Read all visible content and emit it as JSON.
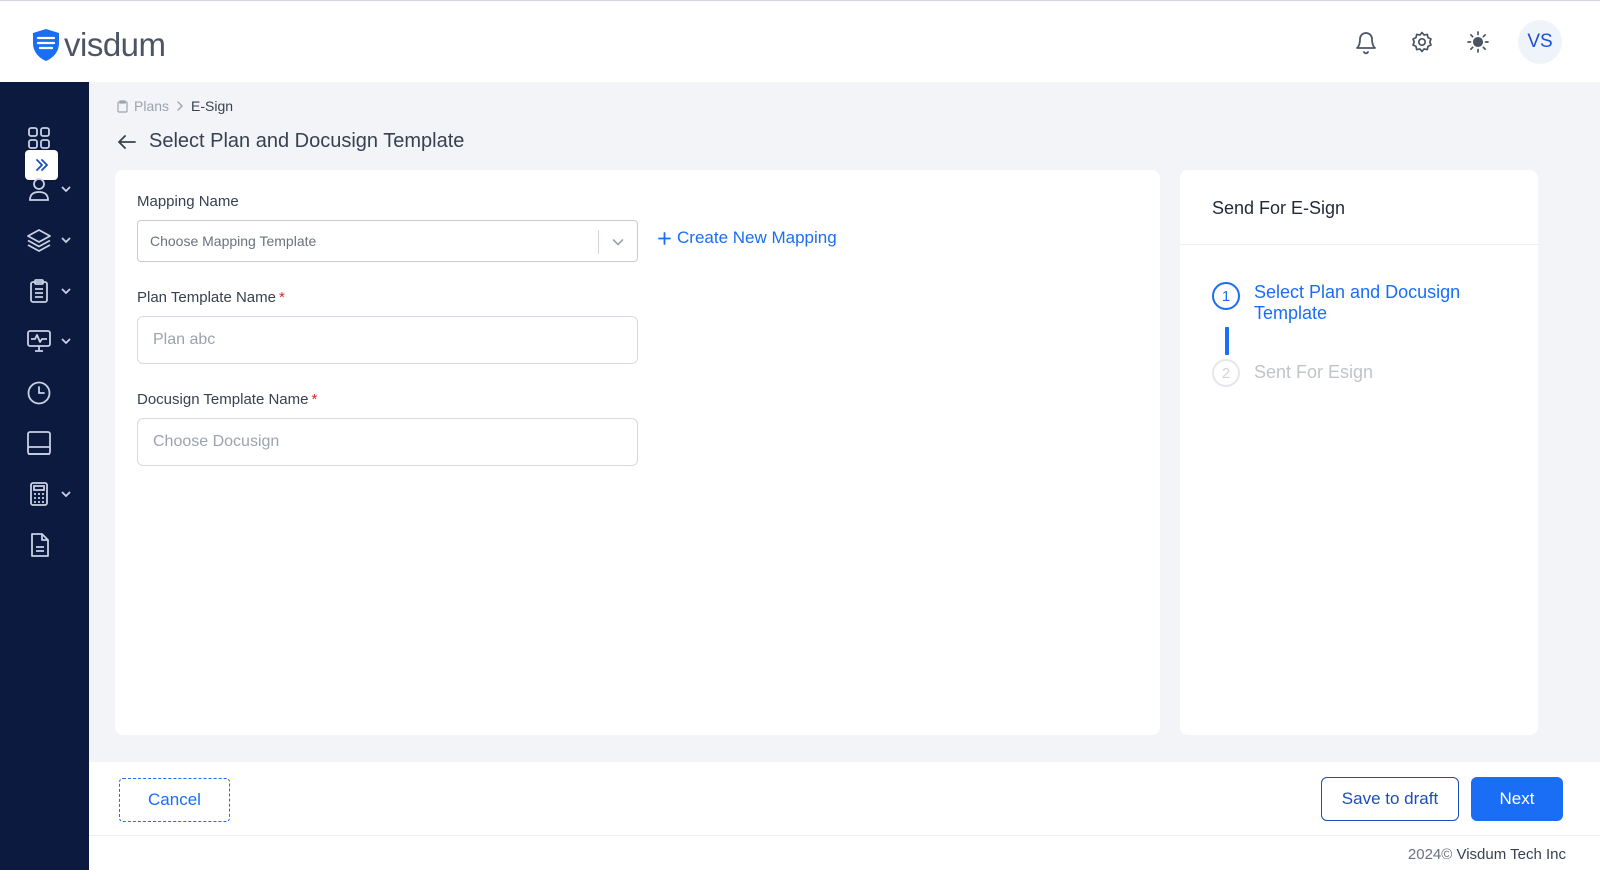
{
  "header": {
    "brand": "visdum",
    "avatar_initials": "VS"
  },
  "sidebar": {
    "items": [
      {
        "icon": "dashboard-grid-icon",
        "has_chevron": false
      },
      {
        "icon": "user-icon",
        "has_chevron": true
      },
      {
        "icon": "layers-icon",
        "has_chevron": true
      },
      {
        "icon": "clipboard-icon",
        "has_chevron": true
      },
      {
        "icon": "monitor-icon",
        "has_chevron": true
      },
      {
        "icon": "clock-icon",
        "has_chevron": false
      },
      {
        "icon": "inbox-icon",
        "has_chevron": false
      },
      {
        "icon": "calculator-icon",
        "has_chevron": true
      },
      {
        "icon": "document-icon",
        "has_chevron": false
      }
    ]
  },
  "breadcrumb": {
    "parent": "Plans",
    "current": "E-Sign"
  },
  "page": {
    "title": "Select Plan and Docusign Template"
  },
  "form": {
    "mapping_label": "Mapping Name",
    "mapping_placeholder": "Choose Mapping Template",
    "create_mapping_label": "Create New Mapping",
    "plan_template_label": "Plan Template Name",
    "plan_template_placeholder": "Plan abc",
    "docusign_label": "Docusign Template Name",
    "docusign_placeholder": "Choose Docusign",
    "required_mark": "*"
  },
  "panel": {
    "title": "Send For E-Sign",
    "steps": [
      {
        "number": "1",
        "label": "Select Plan and Docusign Template",
        "state": "active"
      },
      {
        "number": "2",
        "label": "Sent For Esign",
        "state": "inactive"
      }
    ]
  },
  "footer": {
    "cancel_label": "Cancel",
    "save_draft_label": "Save to draft",
    "next_label": "Next",
    "copyright_year": "2024©",
    "company": "Visdum Tech Inc"
  },
  "colors": {
    "accent": "#1a6ef5",
    "sidebar_bg": "#0b1a3e",
    "page_bg": "#f3f4f7"
  }
}
